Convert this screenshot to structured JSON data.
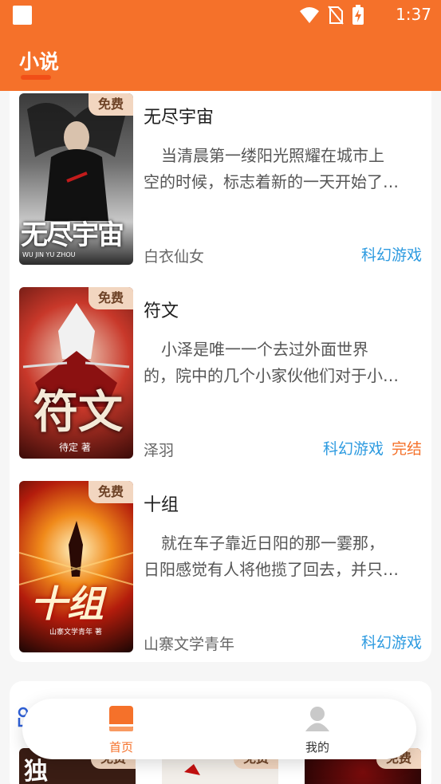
{
  "status_bar": {
    "time": "1:37",
    "icons": [
      "app-square-icon",
      "wifi-icon",
      "no-sim-icon",
      "battery-charging-icon"
    ]
  },
  "header": {
    "title": "小说"
  },
  "books": [
    {
      "title": "无尽宇宙",
      "badge": "免费",
      "desc_lines": [
        "当清晨第一缕阳光照耀在城市上",
        "空的时候，标志着新的一天开始了…"
      ],
      "author": "白衣仙女",
      "genre": "科幻游戏",
      "status": ""
    },
    {
      "title": "符文",
      "badge": "免费",
      "desc_lines": [
        "小泽是唯一一个去过外面世界",
        "的，院中的几个小家伙他们对于小…"
      ],
      "author": "泽羽",
      "genre": "科幻游戏",
      "status": "完结"
    },
    {
      "title": "十组",
      "badge": "免费",
      "desc_lines": [
        "就在车子靠近日阳的那一霎那，",
        "日阳感觉有人将他揽了回去，并只…"
      ],
      "author": "山寨文学青年",
      "genre": "科幻游戏",
      "status": ""
    }
  ],
  "covers": [
    {
      "text": "无尽宇宙",
      "sub": "WU JIN YU ZHOU"
    },
    {
      "text": "符文",
      "sub": "待定 著"
    },
    {
      "text": "十组",
      "sub": "山寨文学青年 著"
    }
  ],
  "peek": {
    "badge": "免费",
    "cover_text": "独"
  },
  "nav": {
    "home": "首页",
    "mine": "我的"
  },
  "colors": {
    "accent": "#f5712a",
    "genre": "#2e9be0",
    "status": "#f5712a",
    "badge_bg": "#f2d6c0"
  }
}
